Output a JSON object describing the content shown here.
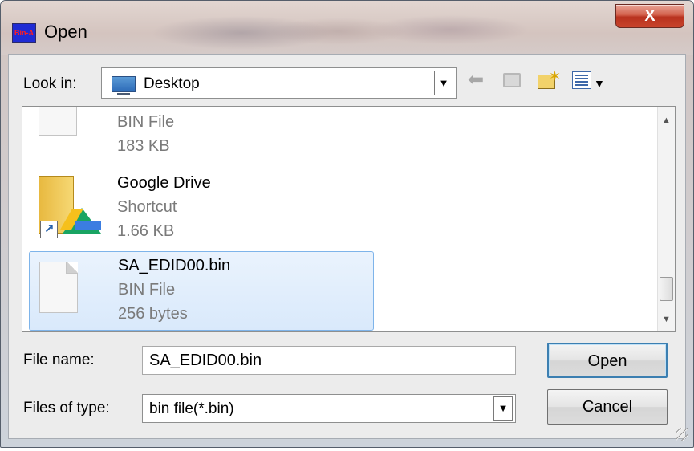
{
  "window": {
    "title": "Open",
    "app_icon_text": "Bin-A",
    "close_label": "X"
  },
  "toolbar": {
    "look_in_label": "Look in:",
    "look_in_value": "Desktop",
    "icons": [
      "back-arrow-icon",
      "up-one-level-icon",
      "new-folder-icon",
      "view-menu-icon"
    ]
  },
  "files": [
    {
      "name": "",
      "type": "BIN File",
      "size": "183 KB",
      "icon": "document-icon",
      "selected": false
    },
    {
      "name": "Google Drive",
      "type": "Shortcut",
      "size": "1.66 KB",
      "icon": "google-drive-folder-icon",
      "selected": false
    },
    {
      "name": "SA_EDID00.bin",
      "type": "BIN File",
      "size": "256 bytes",
      "icon": "document-icon",
      "selected": true
    }
  ],
  "form": {
    "file_name_label": "File name:",
    "file_name_value": "SA_EDID00.bin",
    "file_type_label": "Files of type:",
    "file_type_value": "bin file(*.bin)"
  },
  "buttons": {
    "open": "Open",
    "cancel": "Cancel"
  },
  "colors": {
    "selection_border": "#7eb4ea",
    "close_button": "#c8442c",
    "default_button_border": "#3c7fb1"
  }
}
